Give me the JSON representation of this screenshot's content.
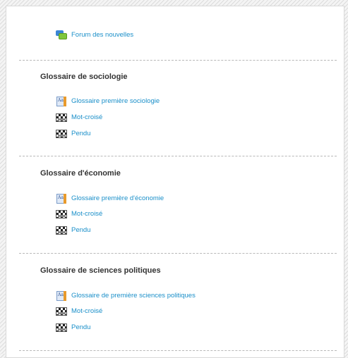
{
  "forum": {
    "label": "Forum des nouvelles"
  },
  "sections": [
    {
      "title": "Glossaire de sociologie",
      "items": [
        {
          "label": "Glossaire première sociologie",
          "icon": "glossary-icon"
        },
        {
          "label": "Mot-croisé",
          "icon": "crossword-icon"
        },
        {
          "label": "Pendu",
          "icon": "hangman-icon"
        }
      ]
    },
    {
      "title": "Glossaire d'économie",
      "items": [
        {
          "label": "Glossaire première d'économie",
          "icon": "glossary-icon"
        },
        {
          "label": "Mot-croisé",
          "icon": "crossword-icon"
        },
        {
          "label": "Pendu",
          "icon": "hangman-icon"
        }
      ]
    },
    {
      "title": "Glossaire de sciences politiques",
      "items": [
        {
          "label": "Glossaire de première sciences politiques",
          "icon": "glossary-icon"
        },
        {
          "label": "Mot-croisé",
          "icon": "crossword-icon"
        },
        {
          "label": "Pendu",
          "icon": "hangman-icon"
        }
      ]
    }
  ],
  "colors": {
    "link": "#1a8fc9",
    "title": "#333333",
    "separator": "#b8b8b8"
  }
}
